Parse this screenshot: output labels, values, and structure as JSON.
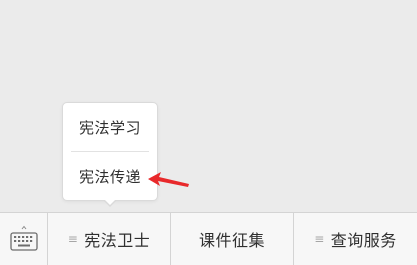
{
  "menu": {
    "items": [
      {
        "label": "宪法卫士",
        "has_submenu": true,
        "submenu_glyph": "≡"
      },
      {
        "label": "课件征集",
        "has_submenu": false
      },
      {
        "label": "查询服务",
        "has_submenu": true,
        "submenu_glyph": "≡"
      }
    ],
    "keyboard_icon": "keyboard-icon"
  },
  "popup": {
    "items": [
      {
        "label": "宪法学习"
      },
      {
        "label": "宪法传递"
      }
    ]
  },
  "annotation": {
    "icon": "red-arrow-icon",
    "color": "#e8292b"
  },
  "colors": {
    "background": "#ebebeb",
    "menu_bar": "#f7f7f7",
    "text": "#2f2f2f",
    "divider": "#d4d4d4"
  }
}
